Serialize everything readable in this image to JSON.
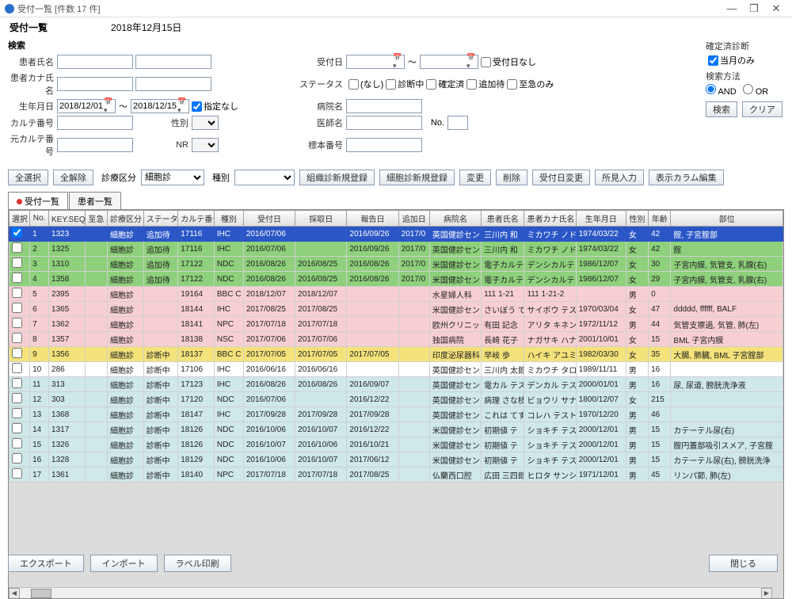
{
  "window_title": "受付一覧 [件数 17 件]",
  "header": {
    "title": "受付一覧",
    "date": "2018年12月15日"
  },
  "search": {
    "label": "検索",
    "f_kanja": "患者氏名",
    "f_kana": "患者カナ氏名",
    "f_dob": "生年月日",
    "f_karte": "カルテ番号",
    "f_motokarute": "元カルテ番号",
    "f_seibetsu": "性別",
    "f_nr": "NR",
    "f_uketsuke": "受付日",
    "f_status": "ステータス",
    "f_byoin": "病院名",
    "f_ishi": "医師名",
    "f_hyohon": "標本番号",
    "dob_from": "2018/12/01",
    "dob_to": "2018/12/15",
    "dob_none": "指定なし",
    "uke_none": "受付日なし",
    "st_none": "(なし)",
    "st_shindan": "診断中",
    "st_kakutei": "確定済",
    "st_tsuika": "追加待",
    "st_shikyu": "至急のみ",
    "tilde": "～",
    "no_lbl": "No."
  },
  "right": {
    "kakutei": "確定済診断",
    "togetsu": "当月のみ",
    "hoho": "検索方法",
    "and": "AND",
    "or": "OR",
    "kensaku": "検索",
    "clear": "クリア"
  },
  "toolbar": {
    "zensen": "全選択",
    "zenkai": "全解除",
    "sinryo_lbl": "診療区分",
    "saibo": "細胞診",
    "shubetsu_lbl": "種別",
    "soshiki_new": "組織診新規登録",
    "saibo_new": "細胞診新規登録",
    "henko": "変更",
    "sakujo": "削除",
    "ukehen": "受付日変更",
    "shoken": "所見入力",
    "hyoji": "表示カラム編集"
  },
  "tabs": {
    "uke": "受付一覧",
    "kanja": "患者一覧"
  },
  "cols": {
    "sel": "選択",
    "no": "No.",
    "key": "KEY.SEQ番",
    "sigu": "至急",
    "sin": "診療区分",
    "stat": "ステータス",
    "kar": "カルテ番号",
    "syu": "種別",
    "uke": "受付日",
    "sai": "採取日",
    "hou": "報告日",
    "tui": "追加日",
    "byo": "病院名",
    "kan": "患者氏名",
    "kana": "患者カナ氏名",
    "sei": "生年月日",
    "sex": "性別",
    "age": "年齢",
    "bui": "部位"
  },
  "rows": [
    {
      "cls": "r-sel",
      "no": "1",
      "key": "1323",
      "sin": "細胞診",
      "stat": "追加待",
      "kar": "17116",
      "syu": "IHC",
      "uke": "2016/07/06",
      "sai": "",
      "hou": "2016/09/26",
      "tui": "2017/0",
      "byo": "英国健診セン",
      "kan": "三川内 和",
      "kana": "ミカワチ ノドカ",
      "sei": "1974/03/22",
      "sex": "女",
      "age": "42",
      "bui": "腟, 子宮腟部"
    },
    {
      "cls": "r-green",
      "no": "2",
      "key": "1325",
      "sin": "細胞診",
      "stat": "追加待",
      "kar": "17116",
      "syu": "IHC",
      "uke": "2016/07/06",
      "sai": "",
      "hou": "2016/09/26",
      "tui": "2017/0",
      "byo": "英国健診セン",
      "kan": "三川内 和",
      "kana": "ミカワチ ノドカ",
      "sei": "1974/03/22",
      "sex": "女",
      "age": "42",
      "bui": "腟"
    },
    {
      "cls": "r-green",
      "no": "3",
      "key": "1310",
      "sin": "細胞診",
      "stat": "追加待",
      "kar": "17122",
      "syu": "NDC",
      "uke": "2016/08/26",
      "sai": "2016/08/25",
      "hou": "2016/08/26",
      "tui": "2017/0",
      "byo": "米国健診セン",
      "kan": "電子カルテ",
      "kana": "デンシカルテ",
      "sei": "1986/12/07",
      "sex": "女",
      "age": "30",
      "bui": "子宮内膜, 気管支, 乳腺(右)"
    },
    {
      "cls": "r-green",
      "no": "4",
      "key": "1358",
      "sin": "細胞診",
      "stat": "追加待",
      "kar": "17122",
      "syu": "NDC",
      "uke": "2016/08/26",
      "sai": "2016/08/25",
      "hou": "2016/08/26",
      "tui": "2017/0",
      "byo": "米国健診セン",
      "kan": "電子カルテ",
      "kana": "デンシカルテ",
      "sei": "1986/12/07",
      "sex": "女",
      "age": "29",
      "bui": "子宮内膜, 気管支, 乳腺(右)"
    },
    {
      "cls": "r-pink",
      "no": "5",
      "key": "2395",
      "sin": "細胞診",
      "stat": "",
      "kar": "19164",
      "syu": "BBC C",
      "uke": "2018/12/07",
      "sai": "2018/12/07",
      "hou": "",
      "tui": "",
      "byo": "水星婦人科",
      "kan": "111 1-21",
      "kana": "111 1-21-2",
      "sei": "",
      "sex": "男",
      "age": "0",
      "bui": ""
    },
    {
      "cls": "r-pink",
      "no": "6",
      "key": "1365",
      "sin": "細胞診",
      "stat": "",
      "kar": "18144",
      "syu": "IHC",
      "uke": "2017/08/25",
      "sai": "2017/08/25",
      "hou": "",
      "tui": "",
      "byo": "米国健診セン",
      "kan": "さいぼう て",
      "kana": "サイボウ テスト",
      "sei": "1970/03/04",
      "sex": "女",
      "age": "47",
      "bui": "ddddd, ffffff, BALF"
    },
    {
      "cls": "r-pink",
      "no": "7",
      "key": "1362",
      "sin": "細胞診",
      "stat": "",
      "kar": "18141",
      "syu": "NPC",
      "uke": "2017/07/18",
      "sai": "2017/07/18",
      "hou": "",
      "tui": "",
      "byo": "欧州クリニック",
      "kan": "有田 記念",
      "kana": "アリタ キネン",
      "sei": "1972/11/12",
      "sex": "男",
      "age": "44",
      "bui": "気管支擦過, 気管, 肺(左)"
    },
    {
      "cls": "r-pink",
      "no": "8",
      "key": "1357",
      "sin": "細胞診",
      "stat": "",
      "kar": "18138",
      "syu": "NSC",
      "uke": "2017/07/06",
      "sai": "2017/07/06",
      "hou": "",
      "tui": "",
      "byo": "独国病院",
      "kan": "長崎 花子",
      "kana": "ナガサキ ハナコ",
      "sei": "2001/10/01",
      "sex": "女",
      "age": "15",
      "bui": "BML 子宮内膜"
    },
    {
      "cls": "r-yellow",
      "no": "9",
      "key": "1356",
      "sin": "細胞診",
      "stat": "診断中",
      "kar": "18137",
      "syu": "BBC C",
      "uke": "2017/07/05",
      "sai": "2017/07/05",
      "hou": "2017/07/05",
      "tui": "",
      "byo": "印度泌尿器科",
      "kan": "早岐 歩",
      "kana": "ハイキ アユミ",
      "sei": "1982/03/30",
      "sex": "女",
      "age": "35",
      "bui": "大腸, 肺臓, BML 子宮腟部"
    },
    {
      "cls": "r-white",
      "no": "10",
      "key": "286",
      "sin": "細胞診",
      "stat": "診断中",
      "kar": "17106",
      "syu": "IHC",
      "uke": "2016/06/16",
      "sai": "2016/06/16",
      "hou": "",
      "tui": "",
      "byo": "英国健診セン",
      "kan": "三川内 太郎",
      "kana": "ミカウチ タロウ",
      "sei": "1989/11/11",
      "sex": "男",
      "age": "16",
      "bui": ""
    },
    {
      "cls": "r-cyan",
      "no": "11",
      "key": "313",
      "sin": "細胞診",
      "stat": "診断中",
      "kar": "17123",
      "syu": "IHC",
      "uke": "2016/08/26",
      "sai": "2016/08/26",
      "hou": "2016/09/07",
      "tui": "",
      "byo": "英国健診セン",
      "kan": "電カル テス",
      "kana": "デンカル テス",
      "sei": "2000/01/01",
      "sex": "男",
      "age": "16",
      "bui": "尿, 尿道, 膀胱洗浄液"
    },
    {
      "cls": "r-cyan",
      "no": "12",
      "key": "303",
      "sin": "細胞診",
      "stat": "診断中",
      "kar": "17120",
      "syu": "NDC",
      "uke": "2016/07/06",
      "sai": "",
      "hou": "2016/12/22",
      "tui": "",
      "byo": "英国健診セン",
      "kan": "病理 さな枝",
      "kana": "ビョウリ サナエ",
      "sei": "1800/12/07",
      "sex": "女",
      "age": "215",
      "bui": ""
    },
    {
      "cls": "r-cyan",
      "no": "13",
      "key": "1368",
      "sin": "細胞診",
      "stat": "診断中",
      "kar": "18147",
      "syu": "IHC",
      "uke": "2017/09/28",
      "sai": "2017/09/28",
      "hou": "2017/09/28",
      "tui": "",
      "byo": "英国健診セン",
      "kan": "これは てすと",
      "kana": "コレハ テスト",
      "sei": "1970/12/20",
      "sex": "男",
      "age": "46",
      "bui": ""
    },
    {
      "cls": "r-cyan",
      "no": "14",
      "key": "1317",
      "sin": "細胞診",
      "stat": "診断中",
      "kar": "18126",
      "syu": "NDC",
      "uke": "2016/10/06",
      "sai": "2016/10/07",
      "hou": "2016/12/22",
      "tui": "",
      "byo": "米国健診セン",
      "kan": "初期値 テ",
      "kana": "ショキチ テスト",
      "sei": "2000/12/01",
      "sex": "男",
      "age": "15",
      "bui": "カテーテル尿(右)"
    },
    {
      "cls": "r-cyan",
      "no": "15",
      "key": "1326",
      "sin": "細胞診",
      "stat": "診断中",
      "kar": "18126",
      "syu": "NDC",
      "uke": "2016/10/07",
      "sai": "2016/10/06",
      "hou": "2016/10/21",
      "tui": "",
      "byo": "米国健診セン",
      "kan": "初期値 テ",
      "kana": "ショキチ テスト",
      "sei": "2000/12/01",
      "sex": "男",
      "age": "15",
      "bui": "腟円蓋部吸引スメア, 子宮腟"
    },
    {
      "cls": "r-cyan",
      "no": "16",
      "key": "1328",
      "sin": "細胞診",
      "stat": "診断中",
      "kar": "18129",
      "syu": "NDC",
      "uke": "2016/10/06",
      "sai": "2016/10/07",
      "hou": "2017/06/12",
      "tui": "",
      "byo": "米国健診セン",
      "kan": "初期値 テ",
      "kana": "ショキチ テスト",
      "sei": "2000/12/01",
      "sex": "男",
      "age": "15",
      "bui": "カテーテル尿(右), 膀胱洗浄"
    },
    {
      "cls": "r-cyan",
      "no": "17",
      "key": "1361",
      "sin": "細胞診",
      "stat": "診断中",
      "kar": "18140",
      "syu": "NPC",
      "uke": "2017/07/18",
      "sai": "2017/07/18",
      "hou": "2017/08/25",
      "tui": "",
      "byo": "仏蘭西口腔",
      "kan": "広田 三四郎",
      "kana": "ヒロタ サンシロウ",
      "sei": "1971/12/01",
      "sex": "男",
      "age": "45",
      "bui": "リンパ節, 肺(左)"
    }
  ],
  "footer": {
    "export": "エクスポート",
    "import": "インポート",
    "label": "ラベル印刷",
    "close": "閉じる"
  }
}
